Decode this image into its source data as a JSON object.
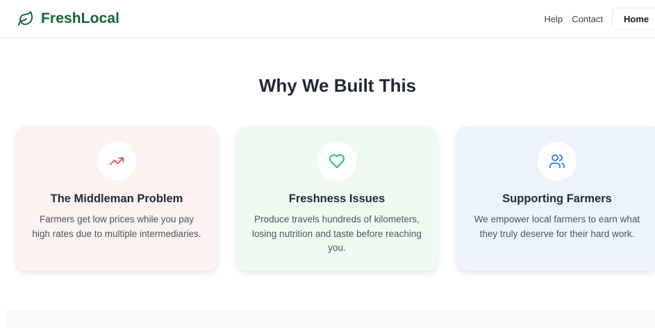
{
  "header": {
    "brand": "FreshLocal",
    "nav": {
      "help": "Help",
      "contact": "Contact",
      "home": "Home"
    }
  },
  "section": {
    "title": "Why We Built This"
  },
  "cards": [
    {
      "icon": "trending-up-icon",
      "title": "The Middleman Problem",
      "text": "Farmers get low prices while you pay high rates due to multiple intermediaries."
    },
    {
      "icon": "heart-icon",
      "title": "Freshness Issues",
      "text": "Produce travels hundreds of kilometers, losing nutrition and taste before reaching you."
    },
    {
      "icon": "users-icon",
      "title": "Supporting Farmers",
      "text": "We empower local farmers to earn what they truly deserve for their hard work."
    }
  ],
  "colors": {
    "brand": "#166534",
    "red_accent": "#e05252",
    "green_accent": "#22c55e",
    "blue_accent": "#3b82f6",
    "red_card": "#fdf1f1",
    "green_card": "#eefaf1",
    "blue_card": "#edf3fd"
  }
}
